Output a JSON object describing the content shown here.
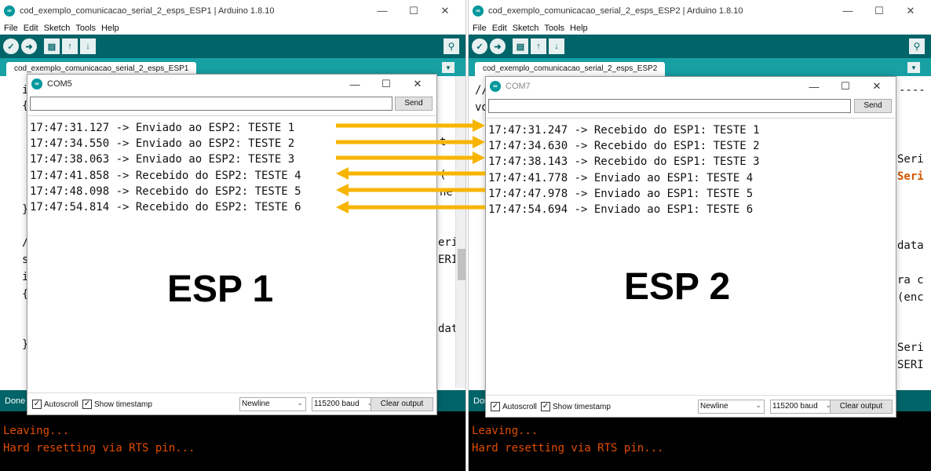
{
  "ide1": {
    "title": "cod_exemplo_comunicacao_serial_2_esps_ESP1 | Arduino 1.8.10",
    "tab": "cod_exemplo_comunicacao_serial_2_esps_ESP1",
    "status": "Done",
    "console": [
      "Leaving...",
      "Hard resetting via RTS pin..."
    ],
    "code_fragments": [
      "i",
      "{",
      "}",
      "/",
      "s",
      "i",
      "{",
      "}",
      "t",
      "(",
      "ne",
      "eri",
      "ERI",
      "dat"
    ]
  },
  "ide2": {
    "title": "cod_exemplo_comunicacao_serial_2_esps_ESP2 | Arduino 1.8.10",
    "tab": "cod_exemplo_comunicacao_serial_2_esps_ESP2",
    "status": "Done",
    "console": [
      "Leaving...",
      "Hard resetting via RTS pin..."
    ],
    "code_fragments": [
      "//",
      "vo",
      "----",
      "Seri",
      "Seri",
      "data",
      "ra c",
      "(enc",
      "Seri",
      "SERI"
    ]
  },
  "menu": [
    "File",
    "Edit",
    "Sketch",
    "Tools",
    "Help"
  ],
  "window_controls": {
    "minimize": "—",
    "maximize": "☐",
    "close": "✕"
  },
  "monitor1": {
    "title": "COM5",
    "send_label": "Send",
    "lines": [
      "17:47:31.127 -> Enviado ao ESP2: TESTE 1",
      "17:47:34.550 -> Enviado ao ESP2: TESTE 2",
      "17:47:38.063 -> Enviado ao ESP2: TESTE 3",
      "17:47:41.858 -> Recebido do ESP2: TESTE 4",
      "17:47:48.098 -> Recebido do ESP2: TESTE 5",
      "17:47:54.814 -> Recebido do ESP2: TESTE 6"
    ],
    "autoscroll_label": "Autoscroll",
    "timestamp_label": "Show timestamp",
    "line_ending": "Newline",
    "baud": "115200 baud",
    "clear_label": "Clear output",
    "big_label": "ESP 1"
  },
  "monitor2": {
    "title": "COM7",
    "send_label": "Send",
    "lines": [
      "17:47:31.247 -> Recebido do ESP1: TESTE 1",
      "17:47:34.630 -> Recebido do ESP1: TESTE 2",
      "17:47:38.143 -> Recebido do ESP1: TESTE 3",
      "17:47:41.778 -> Enviado ao ESP1: TESTE 4",
      "17:47:47.978 -> Enviado ao ESP1: TESTE 5",
      "17:47:54.694 -> Enviado ao ESP1: TESTE 6"
    ],
    "autoscroll_label": "Autoscroll",
    "timestamp_label": "Show timestamp",
    "line_ending": "Newline",
    "baud": "115200 baud",
    "clear_label": "Clear output",
    "big_label": "ESP 2"
  },
  "colors": {
    "arduino_teal": "#006468",
    "tab_bar": "#17a1a5",
    "arrow": "#f7b500",
    "console_text": "#e34c00"
  },
  "arrows": [
    {
      "direction": "to-esp2",
      "message": "TESTE 1"
    },
    {
      "direction": "to-esp2",
      "message": "TESTE 2"
    },
    {
      "direction": "to-esp2",
      "message": "TESTE 3"
    },
    {
      "direction": "to-esp1",
      "message": "TESTE 4"
    },
    {
      "direction": "to-esp1",
      "message": "TESTE 5"
    },
    {
      "direction": "to-esp1",
      "message": "TESTE 6"
    }
  ]
}
